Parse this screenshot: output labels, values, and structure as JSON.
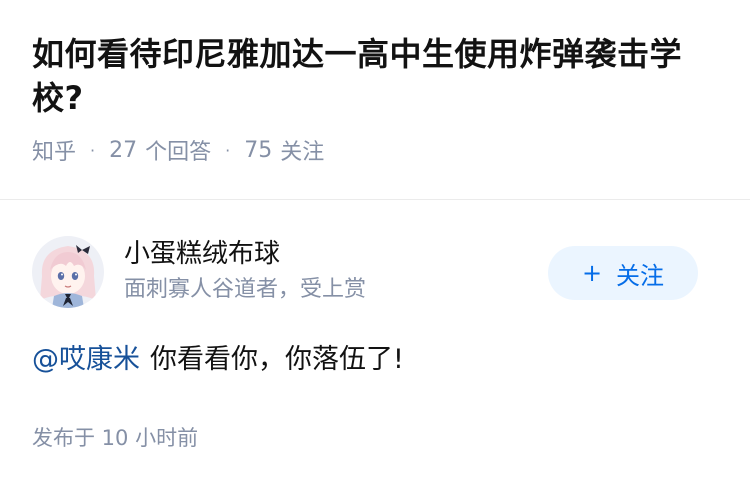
{
  "question": {
    "title": "如何看待印尼雅加达一高中生使用炸弹袭击学校?",
    "source": "知乎",
    "separator": "·",
    "answers_count": "27",
    "answers_label": "个回答",
    "followers_count": "75",
    "followers_label": "关注"
  },
  "author": {
    "name": "小蛋糕绒布球",
    "bio": "面刺寡人谷道者，受上赏",
    "avatar_icon": "anime-girl-avatar"
  },
  "follow_button": {
    "icon": "+",
    "label": "关注"
  },
  "comment": {
    "mention": "@哎康米",
    "text": "你看看你，你落伍了!"
  },
  "publish_time": "发布于 10 小时前",
  "colors": {
    "title": "#121212",
    "meta": "#8590a6",
    "accent": "#056de8",
    "button_bg": "#ebf5ff",
    "link": "#175199"
  }
}
